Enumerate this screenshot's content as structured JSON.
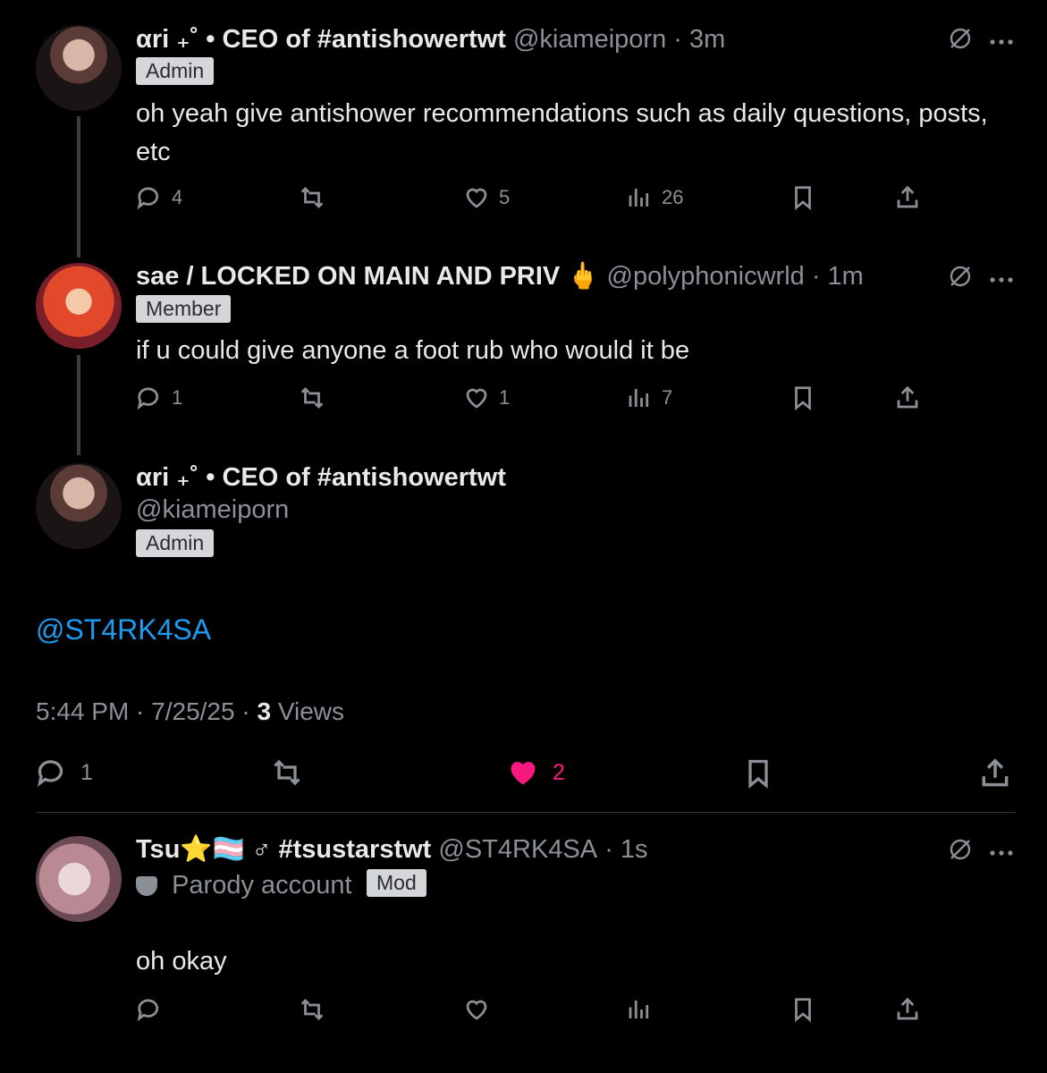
{
  "posts": [
    {
      "name": "αri ₊˚ • CEO of #antishowertwt",
      "handle": "@kiameiporn",
      "time": "· 3m",
      "badge": "Admin",
      "text": "oh yeah give antishower recommendations such as daily questions, posts, etc",
      "replies": "4",
      "retweets": "",
      "likes": "5",
      "views": "26"
    },
    {
      "name": "sae / LOCKED ON MAIN AND PRIV 🖕",
      "handle": "@polyphonicwrld",
      "time": "· 1m",
      "badge": "Member",
      "text": "if u could give anyone a foot rub who would it be",
      "replies": "1",
      "retweets": "",
      "likes": "1",
      "views": "7"
    }
  ],
  "main_post": {
    "name": "αri ₊˚ • CEO of #antishowertwt",
    "handle": "@kiameiporn",
    "badge": "Admin",
    "text": "@ST4RK4SA",
    "timestamp": "5:44 PM · 7/25/25 ·",
    "views_count": "3",
    "views_label": "Views",
    "replies": "1",
    "likes": "2"
  },
  "reply_post": {
    "name": "Tsu⭐🏳️‍⚧️ ♂ #tsustarstwt",
    "handle": "@ST4RK4SA",
    "time": "· 1s",
    "parody": "Parody account",
    "badge": "Mod",
    "text": "oh okay"
  },
  "colors": {
    "like_active": "#f91880",
    "mention": "#1d9bf0"
  },
  "icons": [
    "reply-icon",
    "retweet-icon",
    "like-icon",
    "views-icon",
    "bookmark-icon",
    "share-icon",
    "grok-icon",
    "more-icon",
    "mask-icon"
  ]
}
